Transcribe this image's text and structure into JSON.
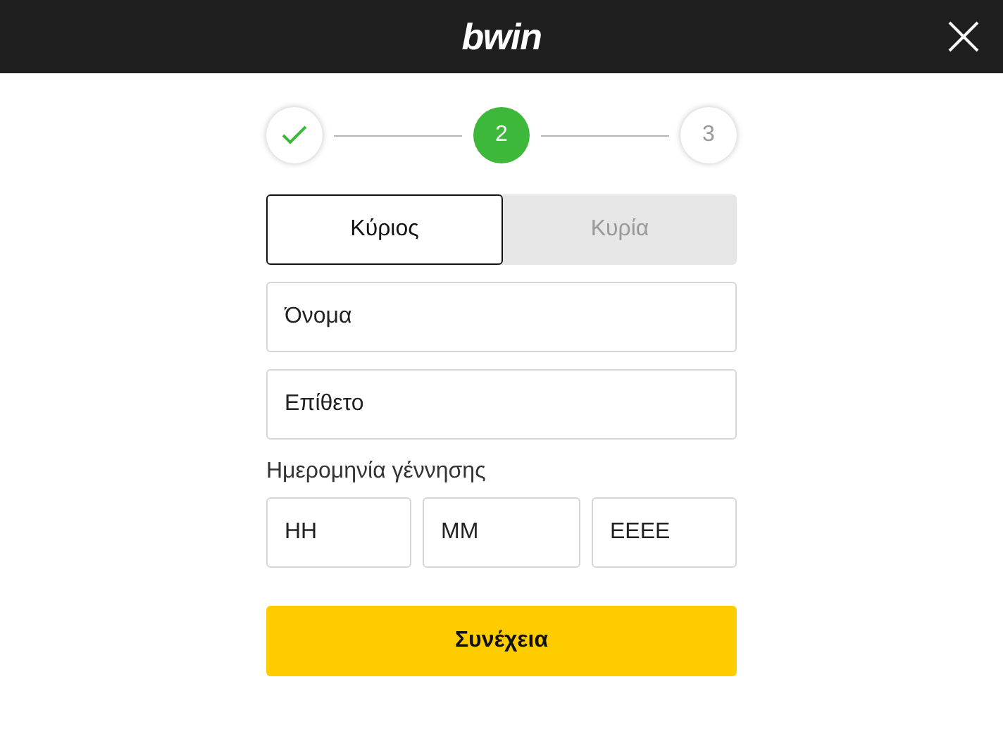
{
  "header": {
    "logo": "bwin"
  },
  "steps": [
    {
      "kind": "done"
    },
    {
      "kind": "current",
      "label": "2"
    },
    {
      "kind": "upcoming",
      "label": "3"
    }
  ],
  "gender": [
    {
      "label": "Κύριος",
      "selected": true
    },
    {
      "label": "Κυρία",
      "selected": false
    }
  ],
  "fields": [
    {
      "placeholder": "Όνομα"
    },
    {
      "placeholder": "Επίθετο"
    }
  ],
  "birth_date": {
    "label": "Ημερομηνία γέννησης",
    "fields": [
      {
        "placeholder": "ΗΗ"
      },
      {
        "placeholder": "ΜΜ"
      },
      {
        "placeholder": "ΕΕΕΕ"
      }
    ]
  },
  "continue_button": "Συνέχεια"
}
